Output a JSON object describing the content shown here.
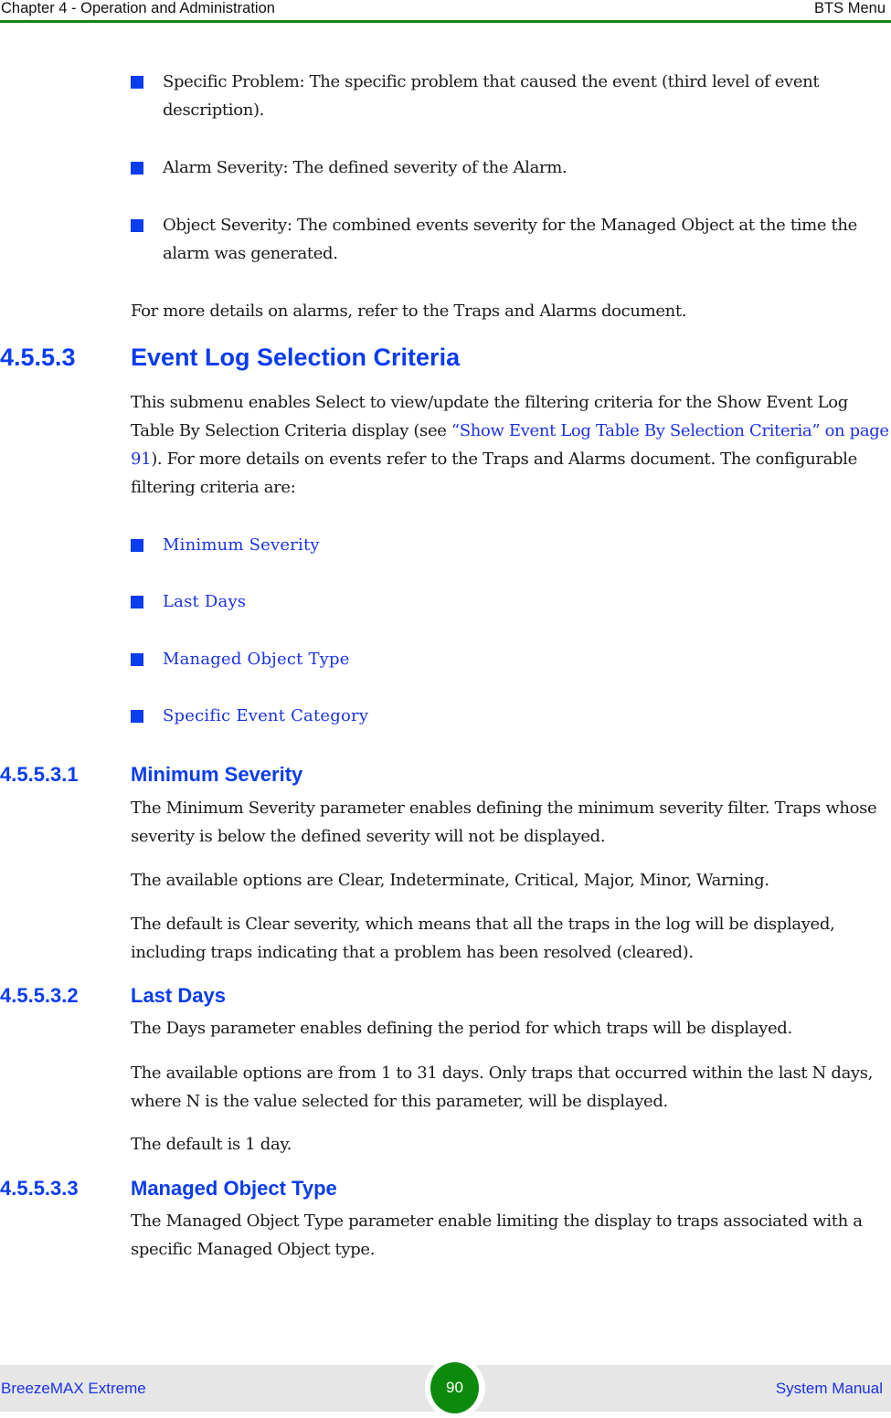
{
  "header": {
    "chapter": "Chapter 4 - Operation and Administration",
    "section": "BTS Menu"
  },
  "intro_bullets": [
    {
      "text": "Specific Problem: The specific problem that caused the event (third level of event description)."
    },
    {
      "text": "Alarm Severity: The defined severity of the Alarm."
    },
    {
      "text": "Object Severity: The combined events severity for the Managed Object at the time the alarm was generated."
    }
  ],
  "alarms_note": "For more details on alarms, refer to the Traps and Alarms document.",
  "section_4553": {
    "number": "4.5.5.3",
    "title": "Event Log Selection Criteria",
    "para_before_link": "This submenu enables Select to view/update the filtering criteria for the Show Event Log Table By Selection Criteria display (see ",
    "link_text": "“Show Event Log Table By Selection Criteria” on page 91",
    "para_after_link": ").  For more details on events refer to the Traps and Alarms document. The configurable filtering criteria are:",
    "criteria": [
      {
        "label": "Minimum Severity"
      },
      {
        "label": "Last Days"
      },
      {
        "label": "Managed Object Type"
      },
      {
        "label": "Specific Event Category"
      }
    ]
  },
  "section_45531": {
    "number": "4.5.5.3.1",
    "title": "Minimum Severity",
    "paragraphs": [
      "The Minimum Severity parameter enables defining the minimum severity filter. Traps whose severity is below the defined severity will not be displayed.",
      "The available options are Clear, Indeterminate, Critical, Major, Minor, Warning.",
      "The default is Clear severity, which means that all the traps in the log will be displayed, including traps indicating that a problem has been resolved (cleared)."
    ]
  },
  "section_45532": {
    "number": "4.5.5.3.2",
    "title": "Last Days",
    "paragraphs": [
      "The Days parameter enables defining the period for which traps will be displayed.",
      "The available options are from 1 to 31 days. Only traps that occurred within the last N days, where N is the value selected for this parameter, will be displayed.",
      "The default is 1 day."
    ]
  },
  "section_45533": {
    "number": "4.5.5.3.3",
    "title": "Managed Object Type",
    "paragraphs": [
      "The Managed Object Type parameter enable limiting the display to traps associated with a specific Managed Object type."
    ]
  },
  "footer": {
    "product": "BreezeMAX Extreme",
    "page_number": "90",
    "doc_type": "System Manual"
  },
  "colors": {
    "heading_blue": "#0a3cf0",
    "link_blue": "#1a32e6",
    "header_rule_green": "#108410",
    "page_badge_green": "#0b8a0b",
    "footer_bg": "#e6e6e6"
  }
}
